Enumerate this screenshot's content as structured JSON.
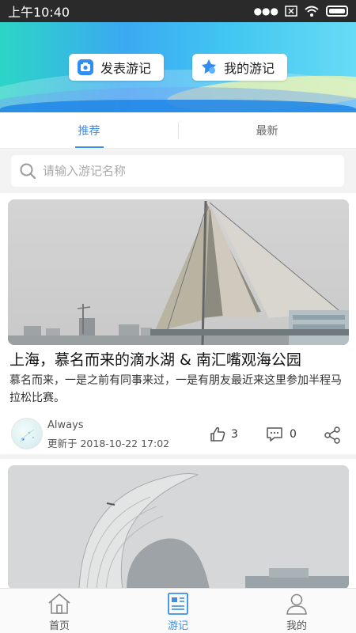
{
  "status_bar": {
    "time": "上午10:40",
    "icons": [
      "dots-icon",
      "close-box-icon",
      "wifi-icon",
      "battery-icon"
    ]
  },
  "header": {
    "publish_label": "发表游记",
    "mine_label": "我的游记"
  },
  "tabs": [
    {
      "label": "推荐",
      "active": true
    },
    {
      "label": "最新",
      "active": false
    }
  ],
  "search": {
    "placeholder": "请输入游记名称",
    "value": ""
  },
  "posts": [
    {
      "title": "上海，慕名而来的滴水湖 & 南汇嘴观海公园",
      "description": "慕名而来，一是之前有同事来过，一是有朋友最近来这里参加半程马拉松比赛。",
      "author": "Always",
      "updated": "更新于 2018-10-22 17:02",
      "likes": "3",
      "comments": "0"
    },
    {
      "title": "",
      "description": ""
    }
  ],
  "bottom_nav": [
    {
      "label": "首页",
      "active": false
    },
    {
      "label": "游记",
      "active": true
    },
    {
      "label": "我的",
      "active": false
    }
  ],
  "colors": {
    "accent": "#3a8ee6",
    "status_bar": "#2a2a2a"
  }
}
